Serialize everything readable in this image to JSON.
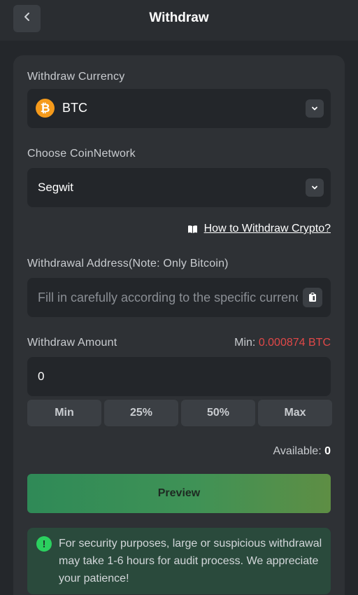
{
  "header": {
    "title": "Withdraw",
    "back_icon": "chevron-left-icon"
  },
  "currency": {
    "label": "Withdraw Currency",
    "value": "BTC",
    "coin_symbol": "₿",
    "coin_color": "#f59a1b"
  },
  "network": {
    "label": "Choose CoinNetwork",
    "value": "Segwit"
  },
  "help_link": {
    "label": "How to Withdraw Crypto?",
    "icon": "book-icon"
  },
  "address": {
    "label": "Withdrawal Address(Note: Only Bitcoin)",
    "placeholder": "Fill in carefully according to the specific currency",
    "paste_icon": "clipboard-icon"
  },
  "amount": {
    "label": "Withdraw Amount",
    "min_prefix": "Min:",
    "min_value": "0.000874 BTC",
    "value": "0",
    "quick_buttons": [
      "Min",
      "25%",
      "50%",
      "Max"
    ],
    "available_label": "Available:",
    "available_value": "0"
  },
  "preview_button": "Preview",
  "notice": {
    "icon": "exclamation-icon",
    "text": "For security purposes, large or suspicious withdrawal may take 1-6 hours for audit process. We appreciate your patience!"
  },
  "colors": {
    "accent_green": "#2bd05f",
    "min_red": "#e04848",
    "btc_orange": "#f59a1b"
  }
}
